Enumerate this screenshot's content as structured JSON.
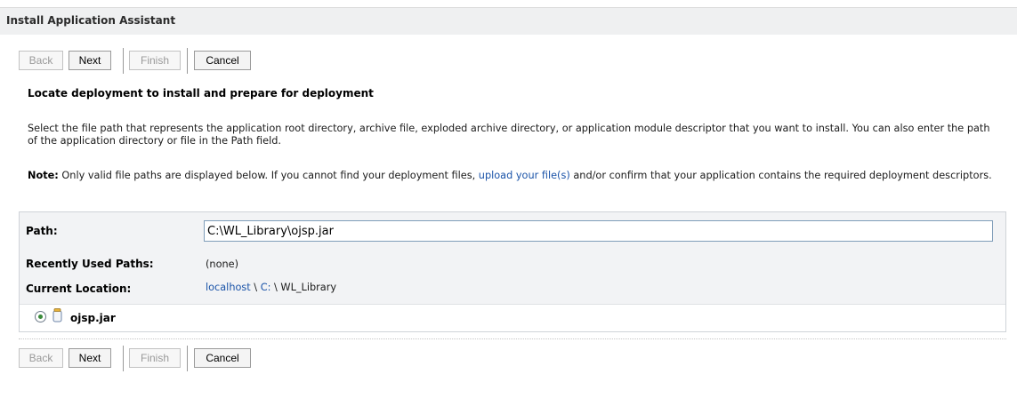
{
  "window": {
    "title": "Install Application Assistant"
  },
  "toolbar_top": {
    "back": "Back",
    "next": "Next",
    "finish": "Finish",
    "cancel": "Cancel"
  },
  "toolbar_bottom": {
    "back": "Back",
    "next": "Next",
    "finish": "Finish",
    "cancel": "Cancel"
  },
  "section": {
    "heading": "Locate deployment to install and prepare for deployment",
    "description": "Select the file path that represents the application root directory, archive file, exploded archive directory, or application module descriptor that you want to install. You can also enter the path of the application directory or file in the Path field.",
    "note_label": "Note:",
    "note_before_link": " Only valid file paths are displayed below. If you cannot find your deployment files, ",
    "note_link": "upload your file(s)",
    "note_after_link": " and/or confirm that your application contains the required deployment descriptors."
  },
  "form": {
    "path_label": "Path:",
    "path_value": "C:\\WL_Library\\ojsp.jar",
    "recent_label": "Recently Used Paths:",
    "recent_value": "(none)",
    "location_label": "Current Location:",
    "location": {
      "host": "localhost",
      "sep1": " \\ ",
      "drive": "C:",
      "sep2": " \\ ",
      "folder": "WL_Library"
    }
  },
  "files": [
    {
      "name": "ojsp.jar",
      "selected": true,
      "icon": "jar-file-icon"
    }
  ]
}
